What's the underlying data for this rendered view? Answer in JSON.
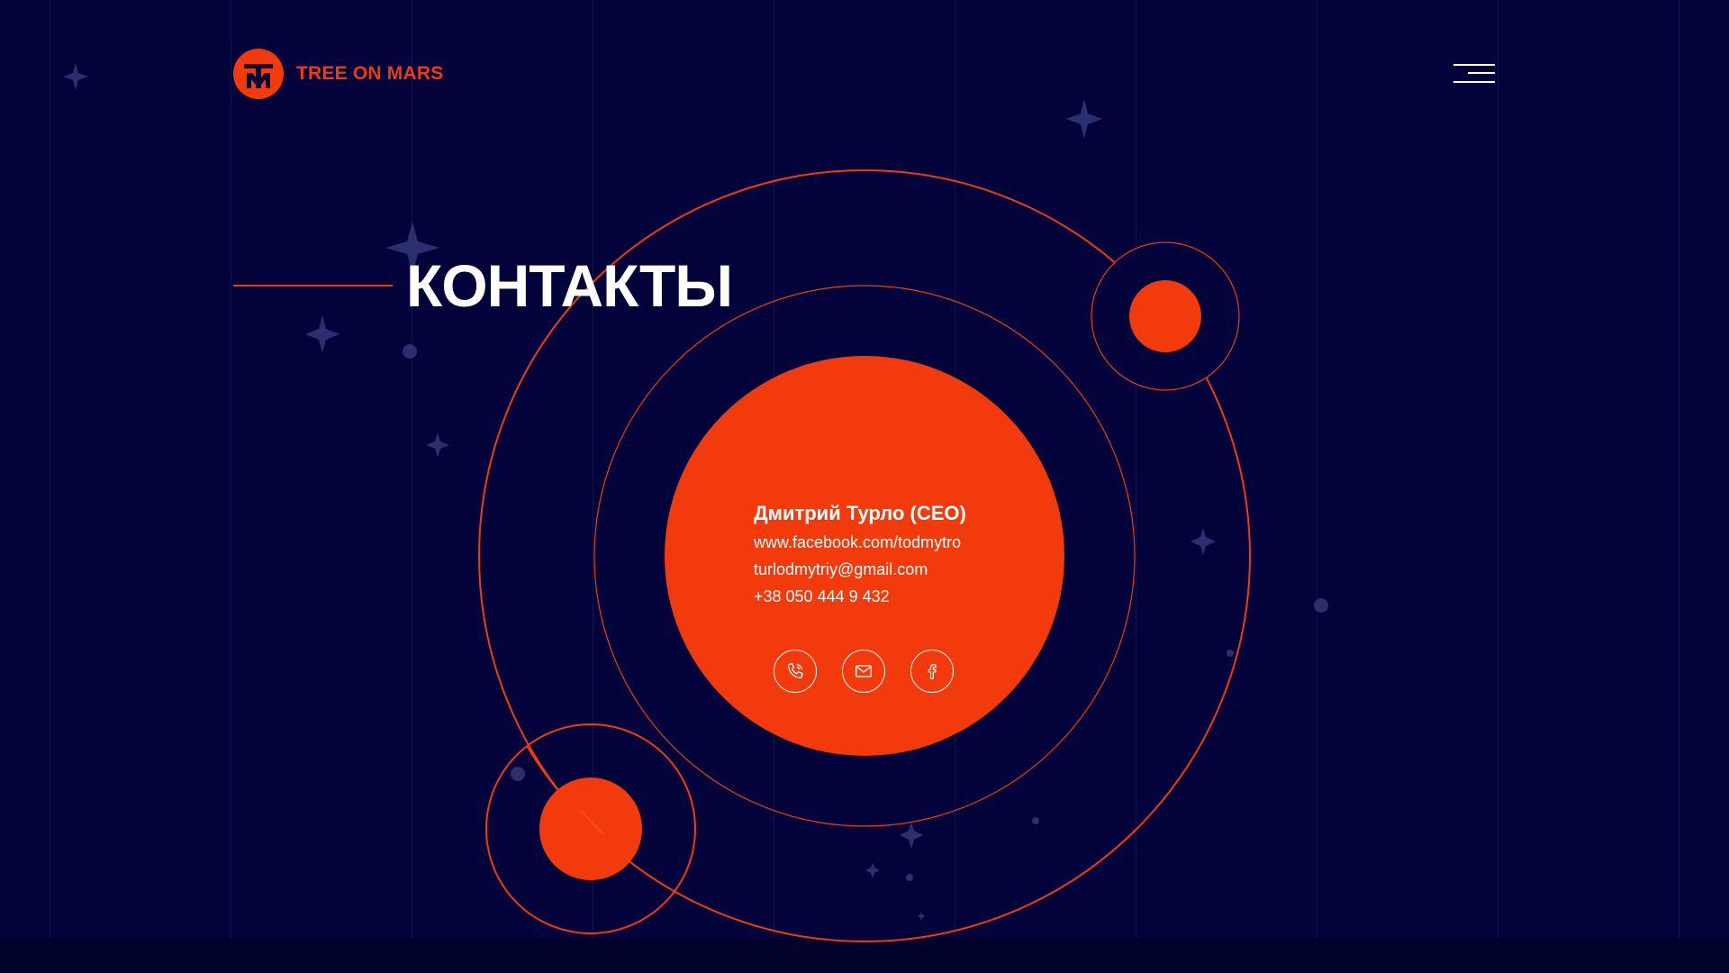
{
  "brand": {
    "name": "TREE ON MARS",
    "accent_color": "#f23a0c",
    "background_color": "#02033a"
  },
  "header": {
    "menu_icon": "hamburger-menu-icon"
  },
  "page": {
    "title": "КОНТАКТЫ"
  },
  "contact": {
    "name": "Дмитрий Турло (CEO)",
    "facebook": "www.facebook.com/todmytro",
    "email": "turlodmytriy@gmail.com",
    "phone": "+38 050 444 9 432"
  },
  "actions": [
    {
      "icon": "phone-icon"
    },
    {
      "icon": "mail-icon"
    },
    {
      "icon": "facebook-icon"
    }
  ]
}
